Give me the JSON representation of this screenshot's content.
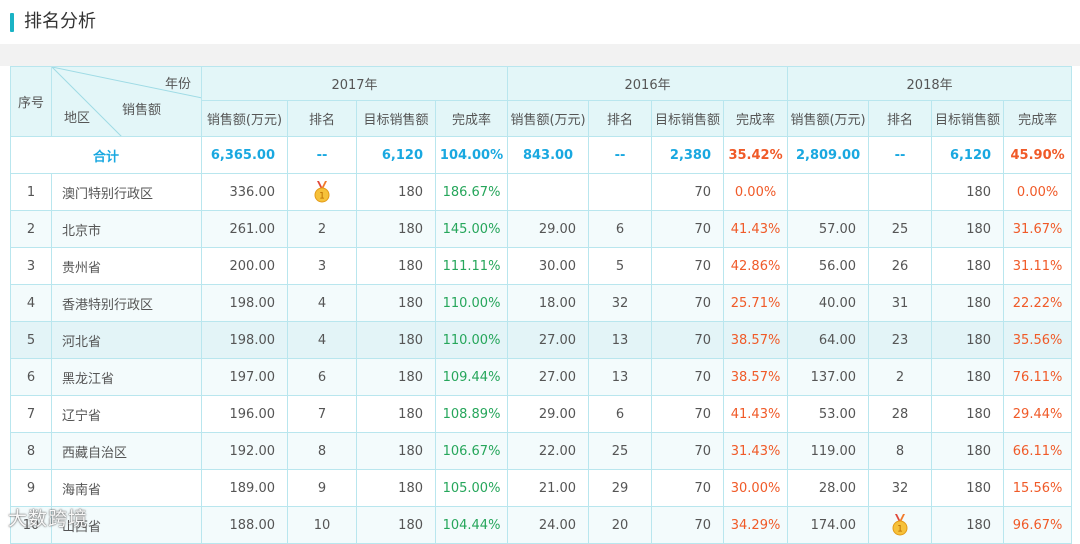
{
  "header": {
    "title": "排名分析"
  },
  "table": {
    "col_index": "序号",
    "corner": {
      "year": "年份",
      "region": "地区",
      "sales": "销售额"
    },
    "years": [
      "2017年",
      "2016年",
      "2018年"
    ],
    "subheaders": [
      "销售额(万元)",
      "排名",
      "目标销售额",
      "完成率"
    ],
    "total": {
      "label": "合计",
      "y2017": [
        "6,365.00",
        "--",
        "6,120",
        "104.00%"
      ],
      "y2016": [
        "843.00",
        "--",
        "2,380",
        "35.42%"
      ],
      "y2018": [
        "2,809.00",
        "--",
        "6,120",
        "45.90%"
      ]
    },
    "rows": [
      {
        "idx": "1",
        "region": "澳门特别行政区",
        "y2017": [
          "336.00",
          "medal",
          "180",
          "186.67%"
        ],
        "y2016": [
          "",
          "",
          "70",
          "0.00%"
        ],
        "y2018": [
          "",
          "",
          "180",
          "0.00%"
        ]
      },
      {
        "idx": "2",
        "region": "北京市",
        "y2017": [
          "261.00",
          "2",
          "180",
          "145.00%"
        ],
        "y2016": [
          "29.00",
          "6",
          "70",
          "41.43%"
        ],
        "y2018": [
          "57.00",
          "25",
          "180",
          "31.67%"
        ]
      },
      {
        "idx": "3",
        "region": "贵州省",
        "y2017": [
          "200.00",
          "3",
          "180",
          "111.11%"
        ],
        "y2016": [
          "30.00",
          "5",
          "70",
          "42.86%"
        ],
        "y2018": [
          "56.00",
          "26",
          "180",
          "31.11%"
        ]
      },
      {
        "idx": "4",
        "region": "香港特别行政区",
        "y2017": [
          "198.00",
          "4",
          "180",
          "110.00%"
        ],
        "y2016": [
          "18.00",
          "32",
          "70",
          "25.71%"
        ],
        "y2018": [
          "40.00",
          "31",
          "180",
          "22.22%"
        ]
      },
      {
        "idx": "5",
        "region": "河北省",
        "y2017": [
          "198.00",
          "4",
          "180",
          "110.00%"
        ],
        "y2016": [
          "27.00",
          "13",
          "70",
          "38.57%"
        ],
        "y2018": [
          "64.00",
          "23",
          "180",
          "35.56%"
        ]
      },
      {
        "idx": "6",
        "region": "黑龙江省",
        "y2017": [
          "197.00",
          "6",
          "180",
          "109.44%"
        ],
        "y2016": [
          "27.00",
          "13",
          "70",
          "38.57%"
        ],
        "y2018": [
          "137.00",
          "2",
          "180",
          "76.11%"
        ]
      },
      {
        "idx": "7",
        "region": "辽宁省",
        "y2017": [
          "196.00",
          "7",
          "180",
          "108.89%"
        ],
        "y2016": [
          "29.00",
          "6",
          "70",
          "41.43%"
        ],
        "y2018": [
          "53.00",
          "28",
          "180",
          "29.44%"
        ]
      },
      {
        "idx": "8",
        "region": "西藏自治区",
        "y2017": [
          "192.00",
          "8",
          "180",
          "106.67%"
        ],
        "y2016": [
          "22.00",
          "25",
          "70",
          "31.43%"
        ],
        "y2018": [
          "119.00",
          "8",
          "180",
          "66.11%"
        ]
      },
      {
        "idx": "9",
        "region": "海南省",
        "y2017": [
          "189.00",
          "9",
          "180",
          "105.00%"
        ],
        "y2016": [
          "21.00",
          "29",
          "70",
          "30.00%"
        ],
        "y2018": [
          "28.00",
          "32",
          "180",
          "15.56%"
        ]
      },
      {
        "idx": "10",
        "region": "山西省",
        "y2017": [
          "188.00",
          "10",
          "180",
          "104.44%"
        ],
        "y2016": [
          "24.00",
          "20",
          "70",
          "34.29%"
        ],
        "y2018": [
          "174.00",
          "medal",
          "180",
          "96.67%"
        ]
      }
    ]
  },
  "watermark": "大数跨境",
  "colors": {
    "accent": "#1ab3c5",
    "header_bg": "#e3f6f8",
    "border": "#b9e6ee",
    "green": "#26a65b",
    "red": "#f05a28",
    "blue": "#19a8e0"
  }
}
